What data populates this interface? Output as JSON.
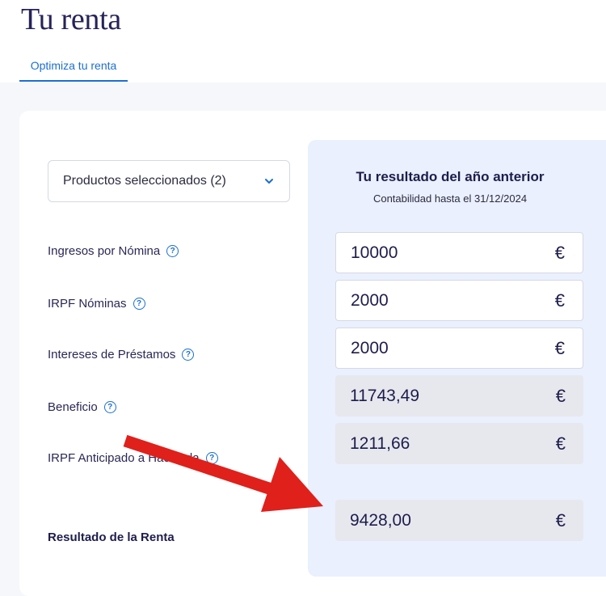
{
  "page": {
    "title": "Tu renta"
  },
  "tabs": [
    {
      "label": "Optimiza tu renta",
      "active": true
    }
  ],
  "filter": {
    "label": "Productos seleccionados (2)"
  },
  "result": {
    "title": "Tu resultado del año anterior",
    "subtitle": "Contabilidad hasta el 31/12/2024"
  },
  "rows": [
    {
      "label": "Ingresos por Nómina",
      "value": "10000",
      "currency": "€",
      "editable": true
    },
    {
      "label": "IRPF Nóminas",
      "value": "2000",
      "currency": "€",
      "editable": true
    },
    {
      "label": "Intereses de Préstamos",
      "value": "2000",
      "currency": "€",
      "editable": true
    },
    {
      "label": "Beneficio",
      "value": "11743,49",
      "currency": "€",
      "editable": false
    },
    {
      "label": "IRPF Anticipado a Hacienda",
      "value": "1211,66",
      "currency": "€",
      "editable": false
    }
  ],
  "total": {
    "label": "Resultado de la Renta",
    "value": "9428,00",
    "currency": "€"
  },
  "colors": {
    "accent": "#1b6fd1",
    "annotation_arrow": "#e0201b",
    "panel": "#eaf0fd"
  },
  "icons": {
    "help": "question-circle-icon",
    "dropdown": "chevron-down-icon"
  }
}
